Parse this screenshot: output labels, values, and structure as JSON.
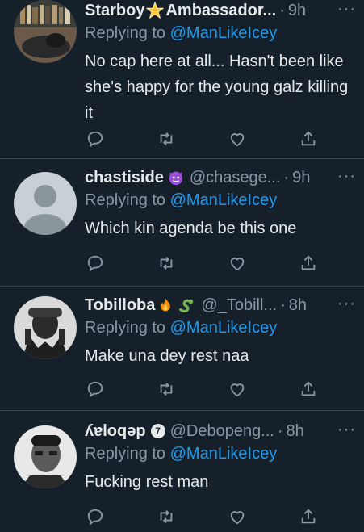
{
  "tweets": [
    {
      "name": "Starboy",
      "name_suffix": "Ambassador...",
      "handle": "",
      "time": "9h",
      "replying_prefix": "Replying to ",
      "replying_to": "@ManLikeIcey",
      "text": "No cap here at all... Hasn't been like she's happy for the young galz killing it"
    },
    {
      "name": "chastiside",
      "handle": "@chasege...",
      "time": "9h",
      "replying_prefix": "Replying to ",
      "replying_to": "@ManLikeIcey",
      "text": "Which kin agenda be this one"
    },
    {
      "name": "Tobilloba",
      "handle": "@_Tobill...",
      "time": "8h",
      "replying_prefix": "Replying to ",
      "replying_to": "@ManLikeIcey",
      "text": "Make una dey rest naa"
    },
    {
      "name": "ʎɐloqəp",
      "handle": "@Debopeng...",
      "time": "8h",
      "replying_prefix": "Replying to ",
      "replying_to": "@ManLikeIcey",
      "text": "Fucking rest man"
    }
  ],
  "icons": [
    "reply-icon",
    "retweet-icon",
    "like-icon",
    "share-icon",
    "more-icon"
  ],
  "colors": {
    "background": "#15202b",
    "link": "#1d9bf0",
    "muted": "#8b98a5",
    "divider": "#38444d"
  }
}
